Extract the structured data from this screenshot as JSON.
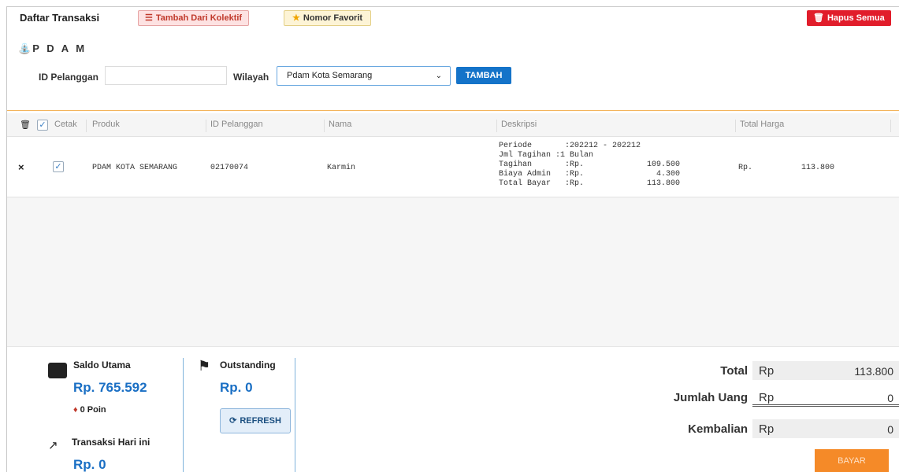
{
  "header": {
    "title": "Daftar Transaksi",
    "kolektif_label": "Tambah Dari Kolektif",
    "favorit_label": "Nomor Favorit",
    "hapus_label": "Hapus Semua"
  },
  "form": {
    "section_title": "P D A M",
    "id_label": "ID Pelanggan",
    "id_value": "",
    "wilayah_label": "Wilayah",
    "wilayah_selected": "Pdam Kota Semarang",
    "tambah_label": "TAMBAH"
  },
  "table": {
    "columns": {
      "cetak": "Cetak",
      "produk": "Produk",
      "id_pelanggan": "ID Pelanggan",
      "nama": "Nama",
      "deskripsi": "Deskripsi",
      "total_harga": "Total Harga"
    },
    "rows": [
      {
        "produk": "PDAM KOTA SEMARANG",
        "id_pelanggan": "02170074",
        "nama": "Karmin",
        "periode_key": "Periode",
        "periode_val": ":202212 - 202212",
        "jml_key": "Jml Tagihan",
        "jml_val": ":1 Bulan",
        "tagihan_key": "Tagihan",
        "tagihan_cur": ":Rp.",
        "tagihan_amt": "109.500",
        "admin_key": "Biaya Admin",
        "admin_cur": ":Rp.",
        "admin_amt": "4.300",
        "total_key": "Total Bayar",
        "total_cur": ":Rp.",
        "total_amt": "113.800",
        "harga_cur": "Rp.",
        "harga_amt": "113.800"
      }
    ]
  },
  "footer": {
    "saldo_label": "Saldo Utama",
    "saldo_value": "Rp. 765.592",
    "poin": "0 Poin",
    "outstanding_label": "Outstanding",
    "outstanding_value": "Rp. 0",
    "refresh_label": "REFRESH",
    "transaksi_label": "Transaksi Hari ini",
    "transaksi_value": "Rp. 0",
    "total_label": "Total",
    "total_rp": "Rp",
    "total_value": "113.800",
    "jumlah_label": "Jumlah Uang",
    "jumlah_rp": "Rp",
    "jumlah_value": "0",
    "kembalian_label": "Kembalian",
    "kembalian_rp": "Rp",
    "kembalian_value": "0",
    "bayar_label": "BAYAR"
  },
  "colors": {
    "accent_blue": "#1473c9",
    "danger_red": "#e11d2b",
    "bayar_orange": "#f58a28"
  }
}
